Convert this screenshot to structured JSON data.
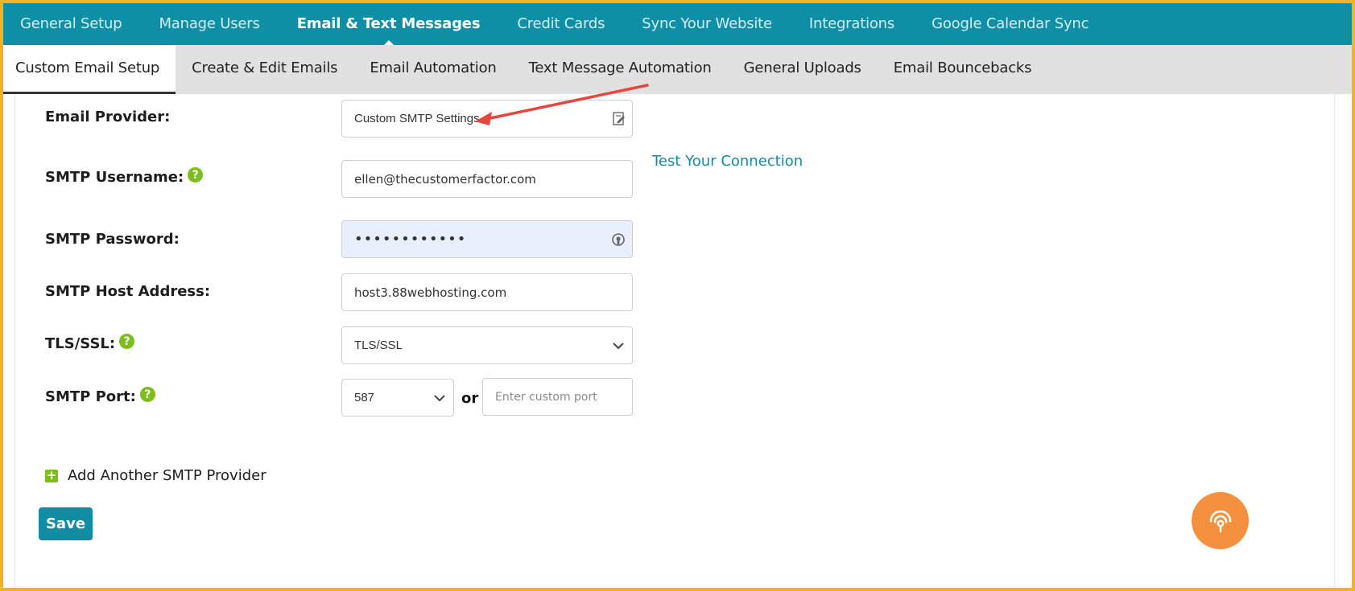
{
  "top_nav": {
    "tabs": [
      {
        "label": "General Setup"
      },
      {
        "label": "Manage Users"
      },
      {
        "label": "Email & Text Messages",
        "active": true
      },
      {
        "label": "Credit Cards"
      },
      {
        "label": "Sync Your Website"
      },
      {
        "label": "Integrations"
      },
      {
        "label": "Google Calendar Sync"
      }
    ]
  },
  "sub_nav": {
    "tabs": [
      {
        "label": "Custom Email Setup",
        "active": true
      },
      {
        "label": "Create & Edit Emails"
      },
      {
        "label": "Email Automation"
      },
      {
        "label": "Text Message Automation"
      },
      {
        "label": "General Uploads"
      },
      {
        "label": "Email Bouncebacks"
      }
    ]
  },
  "form": {
    "email_provider": {
      "label": "Email Provider:",
      "value": "Custom SMTP Settings"
    },
    "smtp_username": {
      "label": "SMTP Username:",
      "value": "ellen@thecustomerfactor.com"
    },
    "smtp_password": {
      "label": "SMTP Password:",
      "value": "••••••••••••"
    },
    "smtp_host": {
      "label": "SMTP Host Address:",
      "value": "host3.88webhosting.com"
    },
    "tls_ssl": {
      "label": "TLS/SSL:",
      "value": "TLS/SSL"
    },
    "smtp_port": {
      "label": "SMTP Port:",
      "value": "587",
      "or_text": "or",
      "custom_placeholder": "Enter custom port"
    },
    "help_glyph": "?"
  },
  "test_connection_label": "Test Your Connection",
  "add_provider_label": "Add Another SMTP Provider",
  "add_glyph": "+",
  "save_label": "Save",
  "icons": {
    "provider_edit": "edit-document-icon",
    "password_reveal": "key-icon",
    "dropdown": "chevron-down-icon",
    "fab": "broadcast-signal-icon"
  },
  "colors": {
    "nav_bg": "#0f8fa6",
    "subnav_bg": "#e1e1e1",
    "help_green": "#7cbe1b",
    "link": "#1888a3",
    "save_bg": "#128ca3",
    "fab_bg": "#f5913e",
    "annotation_arrow": "#e8453c",
    "frame_border": "#f1b224"
  }
}
